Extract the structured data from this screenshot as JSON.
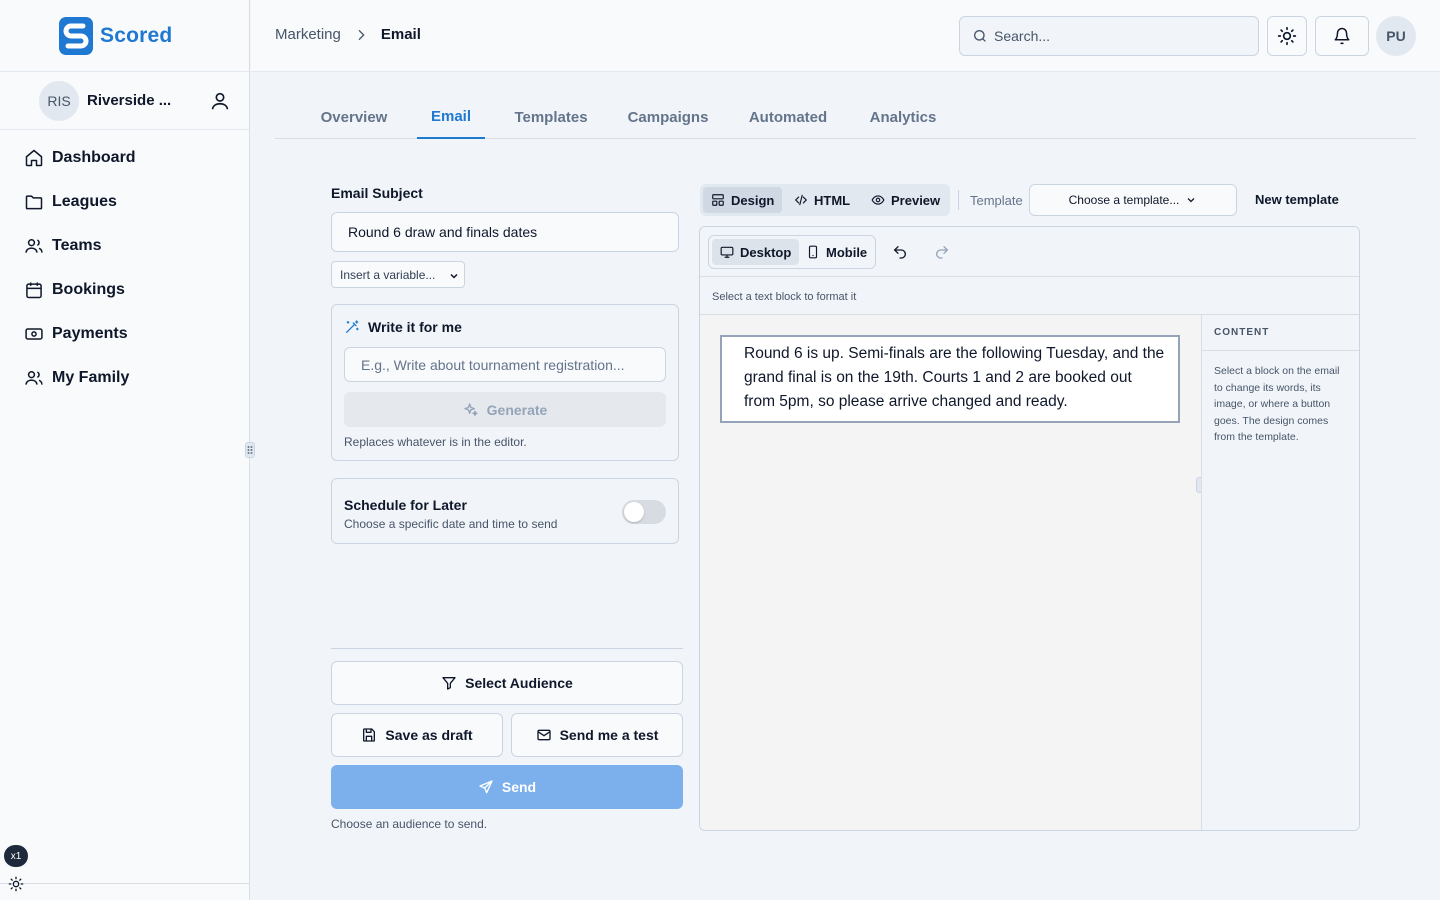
{
  "app": {
    "name": "Scored",
    "brand_color": "#1f78d1"
  },
  "sidebar": {
    "org": {
      "initials": "RIS",
      "name": "Riverside ..."
    },
    "items": [
      {
        "label": "Dashboard",
        "icon": "home-icon"
      },
      {
        "label": "Leagues",
        "icon": "folder-icon"
      },
      {
        "label": "Teams",
        "icon": "users-icon"
      },
      {
        "label": "Bookings",
        "icon": "calendar-icon"
      },
      {
        "label": "Payments",
        "icon": "banknote-icon"
      },
      {
        "label": "My Family",
        "icon": "users-icon"
      }
    ],
    "zoom_badge": "x1"
  },
  "header": {
    "breadcrumb": {
      "parent": "Marketing",
      "current": "Email"
    },
    "search_placeholder": "Search...",
    "user_initials": "PU"
  },
  "tabs": [
    {
      "label": "Overview",
      "active": false
    },
    {
      "label": "Email",
      "active": true
    },
    {
      "label": "Templates",
      "active": false
    },
    {
      "label": "Campaigns",
      "active": false
    },
    {
      "label": "Automated",
      "active": false
    },
    {
      "label": "Analytics",
      "active": false
    }
  ],
  "compose": {
    "subject_label": "Email Subject",
    "subject_value": "Round 6 draw and finals dates",
    "variable_select": "Insert a variable...",
    "ai": {
      "title": "Write it for me",
      "placeholder": "E.g., Write about tournament registration...",
      "generate_label": "Generate",
      "hint": "Replaces whatever is in the editor."
    },
    "schedule": {
      "title": "Schedule for Later",
      "subtitle": "Choose a specific date and time to send",
      "enabled": false
    },
    "select_audience_label": "Select Audience",
    "save_draft_label": "Save as draft",
    "send_test_label": "Send me a test",
    "send_label": "Send",
    "send_hint": "Choose an audience to send."
  },
  "editor": {
    "modes": [
      {
        "label": "Design",
        "active": true
      },
      {
        "label": "HTML",
        "active": false
      },
      {
        "label": "Preview",
        "active": false
      }
    ],
    "template_label": "Template",
    "template_select": "Choose a template...",
    "new_template_label": "New template",
    "devices": [
      {
        "label": "Desktop",
        "active": true
      },
      {
        "label": "Mobile",
        "active": false
      }
    ],
    "hint": "Select a text block to format it",
    "body_text": "Round 6 is up. Semi-finals are the following Tuesday, and the grand final is on the 19th. Courts 1 and 2 are booked out from 5pm, so please arrive changed and ready.",
    "content_panel": {
      "title": "CONTENT",
      "body": "Select a block on the email to change its words, its image, or where a button goes. The design comes from the template."
    }
  }
}
